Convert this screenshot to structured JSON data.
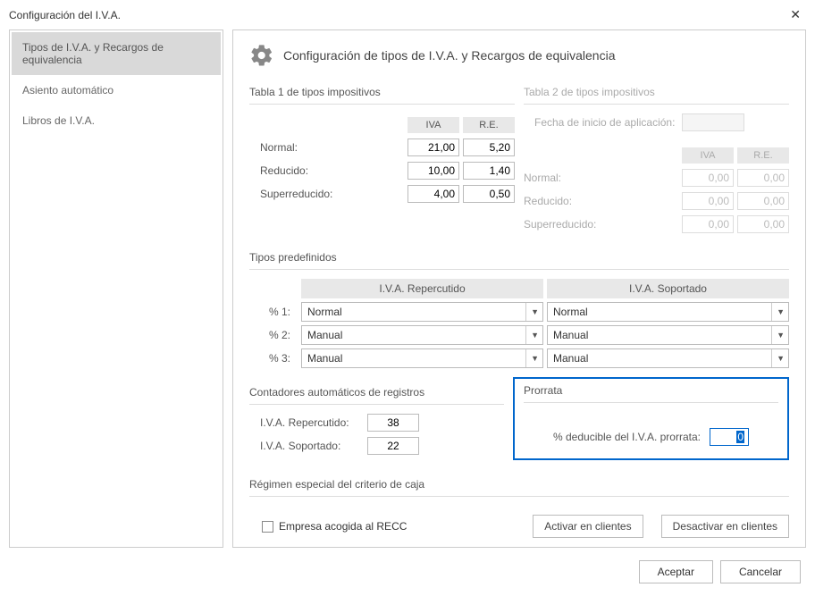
{
  "window": {
    "title": "Configuración del I.V.A."
  },
  "sidebar": {
    "items": [
      "Tipos de I.V.A. y Recargos de equivalencia",
      "Asiento automático",
      "Libros de I.V.A."
    ]
  },
  "header": {
    "title": "Configuración de tipos de I.V.A. y Recargos de equivalencia"
  },
  "table1": {
    "title": "Tabla 1 de tipos impositivos",
    "hdr_iva": "IVA",
    "hdr_re": "R.E.",
    "rows": {
      "normal_label": "Normal:",
      "normal_iva": "21,00",
      "normal_re": "5,20",
      "reducido_label": "Reducido:",
      "reducido_iva": "10,00",
      "reducido_re": "1,40",
      "super_label": "Superreducido:",
      "super_iva": "4,00",
      "super_re": "0,50"
    }
  },
  "table2": {
    "title": "Tabla 2 de tipos impositivos",
    "date_label": "Fecha de inicio de aplicación:",
    "hdr_iva": "IVA",
    "hdr_re": "R.E.",
    "rows": {
      "normal_label": "Normal:",
      "normal_iva": "0,00",
      "normal_re": "0,00",
      "reducido_label": "Reducido:",
      "reducido_iva": "0,00",
      "reducido_re": "0,00",
      "super_label": "Superreducido:",
      "super_iva": "0,00",
      "super_re": "0,00"
    }
  },
  "predef": {
    "title": "Tipos predefinidos",
    "hdr_rep": "I.V.A. Repercutido",
    "hdr_sop": "I.V.A. Soportado",
    "row1_label": "% 1:",
    "row1_rep": "Normal",
    "row1_sop": "Normal",
    "row2_label": "% 2:",
    "row2_rep": "Manual",
    "row2_sop": "Manual",
    "row3_label": "% 3:",
    "row3_rep": "Manual",
    "row3_sop": "Manual"
  },
  "counters": {
    "title": "Contadores automáticos de registros",
    "rep_label": "I.V.A. Repercutido:",
    "rep_value": "38",
    "sop_label": "I.V.A. Soportado:",
    "sop_value": "22"
  },
  "prorrata": {
    "title": "Prorrata",
    "label": "% deducible del I.V.A. prorrata:",
    "value": "0"
  },
  "recc": {
    "title": "Régimen especial del criterio de caja",
    "checkbox_label": "Empresa acogida al RECC",
    "btn_activate": "Activar en clientes",
    "btn_deactivate": "Desactivar en clientes"
  },
  "footer": {
    "accept": "Aceptar",
    "cancel": "Cancelar"
  }
}
